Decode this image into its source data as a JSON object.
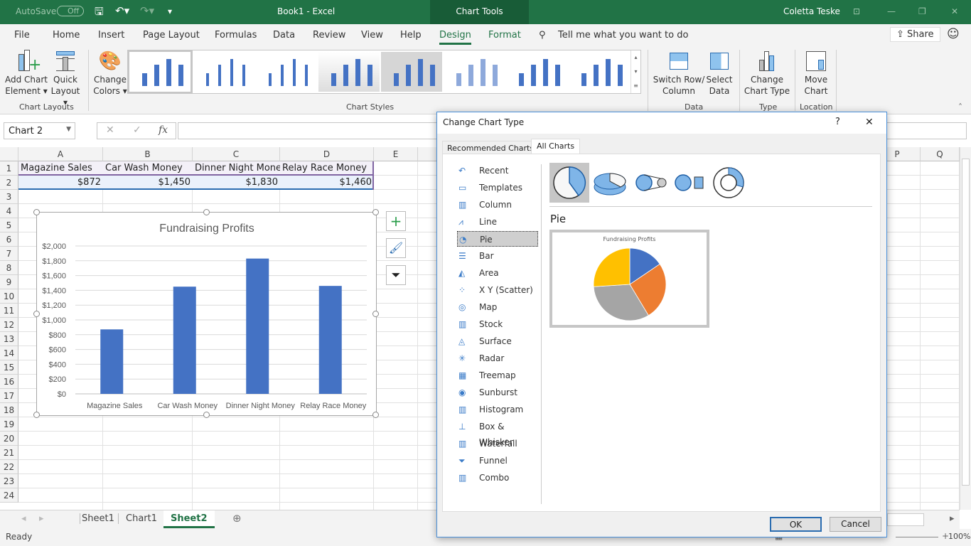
{
  "titlebar": {
    "autosave": "AutoSave",
    "autosave_state": "Off",
    "doc_title": "Book1  -  Excel",
    "context_tab": "Chart Tools",
    "user": "Coletta Teske"
  },
  "menu": {
    "items": [
      "File",
      "Home",
      "Insert",
      "Page Layout",
      "Formulas",
      "Data",
      "Review",
      "View",
      "Help",
      "Design",
      "Format"
    ],
    "active": "Design",
    "tellme": "Tell me what you want to do",
    "share": "Share"
  },
  "ribbon": {
    "add_chart_element": [
      "Add Chart",
      "Element"
    ],
    "quick_layout": [
      "Quick",
      "Layout"
    ],
    "change_colors": [
      "Change",
      "Colors"
    ],
    "group_chart_layouts": "Chart Layouts",
    "group_chart_styles": "Chart Styles",
    "switch_row_col": [
      "Switch Row/",
      "Column"
    ],
    "select_data": [
      "Select",
      "Data"
    ],
    "group_data": "Data",
    "change_chart_type": [
      "Change",
      "Chart Type"
    ],
    "group_type": "Type",
    "move_chart": [
      "Move",
      "Chart"
    ],
    "group_location": "Location"
  },
  "formula_bar": {
    "name_box": "Chart 2",
    "fx": "fx",
    "value": ""
  },
  "sheet": {
    "columns": [
      "A",
      "B",
      "C",
      "D",
      "E",
      "P",
      "Q"
    ],
    "rows": [
      "1",
      "2",
      "3",
      "4",
      "5",
      "6",
      "7",
      "8",
      "9",
      "10",
      "11",
      "12",
      "13",
      "14",
      "15",
      "16",
      "17",
      "18",
      "19",
      "20",
      "21",
      "22",
      "23",
      "24"
    ],
    "row1": [
      "Magazine Sales",
      "Car Wash Money",
      "Dinner Night Money",
      "Relay Race Money"
    ],
    "row2": [
      "$872",
      "$1,450",
      "$1,830",
      "$1,460"
    ]
  },
  "chart_data": {
    "type": "bar",
    "title": "Fundraising Profits",
    "categories": [
      "Magazine Sales",
      "Car Wash Money",
      "Dinner Night Money",
      "Relay Race Money"
    ],
    "values": [
      872,
      1450,
      1830,
      1460
    ],
    "ylim": [
      0,
      2000
    ],
    "yticks": [
      "$0",
      "$200",
      "$400",
      "$600",
      "$800",
      "$1,000",
      "$1,200",
      "$1,400",
      "$1,600",
      "$1,800",
      "$2,000"
    ],
    "grid": true,
    "bar_color": "#4472c4"
  },
  "dialog": {
    "title": "Change Chart Type",
    "help": "?",
    "close": "✕",
    "tabs": [
      "Recommended Charts",
      "All Charts"
    ],
    "active_tab": "All Charts",
    "types": [
      "Recent",
      "Templates",
      "Column",
      "Line",
      "Pie",
      "Bar",
      "Area",
      "X Y (Scatter)",
      "Map",
      "Stock",
      "Surface",
      "Radar",
      "Treemap",
      "Sunburst",
      "Histogram",
      "Box & Whisker",
      "Waterfall",
      "Funnel",
      "Combo"
    ],
    "selected_type": "Pie",
    "subtype_heading": "Pie",
    "preview_title": "Fundraising Profits",
    "pie_colors": [
      "#4472c4",
      "#ed7d31",
      "#a5a5a5",
      "#ffc000"
    ],
    "ok": "OK",
    "cancel": "Cancel"
  },
  "sheet_tabs": {
    "tabs": [
      "Sheet1",
      "Chart1",
      "Sheet2"
    ],
    "active": "Sheet2"
  },
  "status": {
    "text": "Ready",
    "zoom": "100%"
  }
}
